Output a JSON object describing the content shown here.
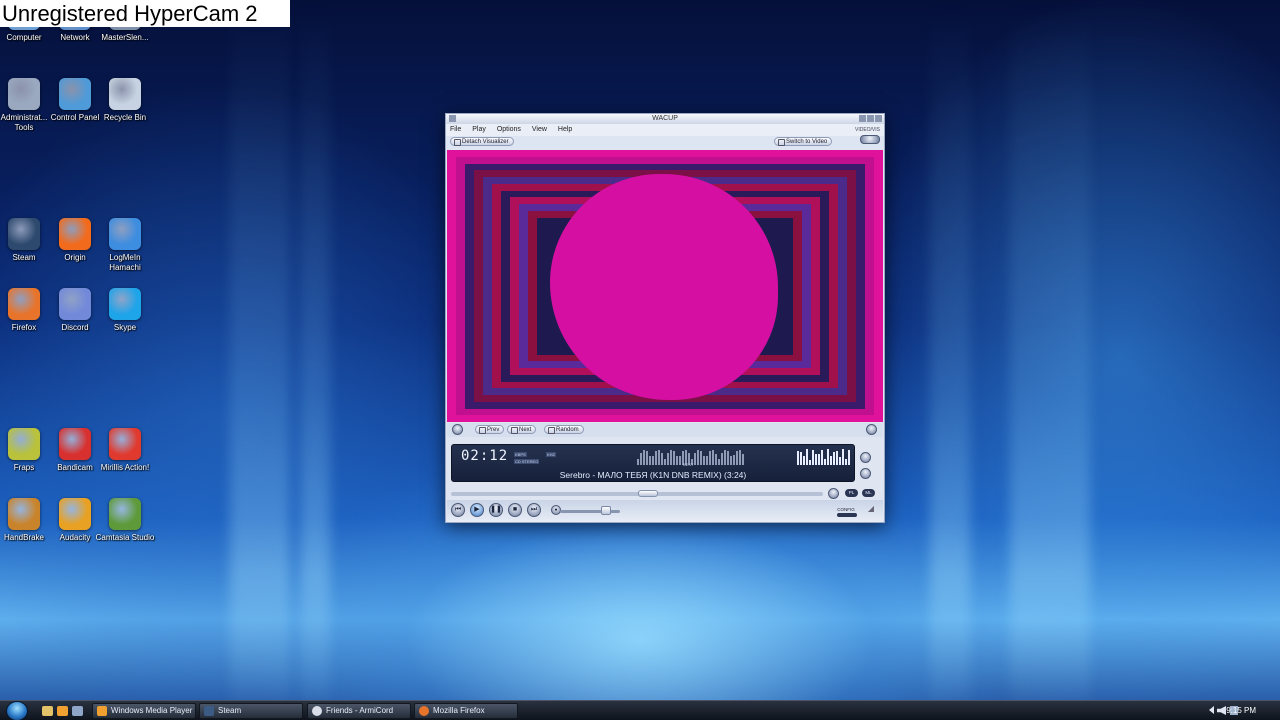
{
  "watermark": "Unregistered HyperCam 2",
  "desktop_icons": [
    {
      "label": "Computer",
      "color": "#6aa0d8"
    },
    {
      "label": "Network",
      "color": "#5b8fcf"
    },
    {
      "label": "MasterSlen...",
      "color": "#7c8fa8"
    },
    {
      "label": "Administrat... Tools",
      "color": "#9aa9c0"
    },
    {
      "label": "Control Panel",
      "color": "#4f9ad8"
    },
    {
      "label": "Recycle Bin",
      "color": "#c7d3e2"
    },
    {
      "label": "Steam",
      "color": "#2d4a6e"
    },
    {
      "label": "Origin",
      "color": "#f26b1d"
    },
    {
      "label": "LogMeIn Hamachi",
      "color": "#3d8de0"
    },
    {
      "label": "Firefox",
      "color": "#e8742b"
    },
    {
      "label": "Discord",
      "color": "#7289da"
    },
    {
      "label": "Skype",
      "color": "#1ea4e9"
    },
    {
      "label": "Fraps",
      "color": "#b9c23a"
    },
    {
      "label": "Bandicam",
      "color": "#d8302e"
    },
    {
      "label": "Mirillis Action!",
      "color": "#e03a2f"
    },
    {
      "label": "HandBrake",
      "color": "#c9842b"
    },
    {
      "label": "Audacity",
      "color": "#e8a122"
    },
    {
      "label": "Camtasia Studio",
      "color": "#5e9a3a"
    }
  ],
  "player": {
    "title": "WACUP",
    "menu": [
      "File",
      "Play",
      "Options",
      "View",
      "Help"
    ],
    "menu_right": "VIDEO/VIS",
    "detach_label": "Detach Visualizer",
    "switch_label": "Switch to Video",
    "prev_label": "Prev",
    "next_label": "Next",
    "random_label": "Random",
    "time": "02:12",
    "tags": [
      "KBPS",
      "KHZ",
      "CD STEREO"
    ],
    "best_label": "BEST",
    "track": "Serebro - МАЛО ТЕБЯ (K1N DNB REMIX) (3:24)",
    "seek_progress": 0.53,
    "volume": 0.82,
    "small_buttons": [
      "PL",
      "ML"
    ],
    "config_label": "CONFIG",
    "visualizer_colors": {
      "blob": "#d40fa2",
      "outer": "#e0119b",
      "inner": "#1a1a5a"
    }
  },
  "taskbar": {
    "items": [
      {
        "label": "Windows Media Player",
        "color": "#f0a030"
      },
      {
        "label": "Steam",
        "color": "#3b5b85"
      },
      {
        "label": "Friends - ArmiCord",
        "color": "#d8dde8"
      },
      {
        "label": "Mozilla Firefox",
        "color": "#e8742b"
      }
    ],
    "time": "9:15 PM"
  }
}
